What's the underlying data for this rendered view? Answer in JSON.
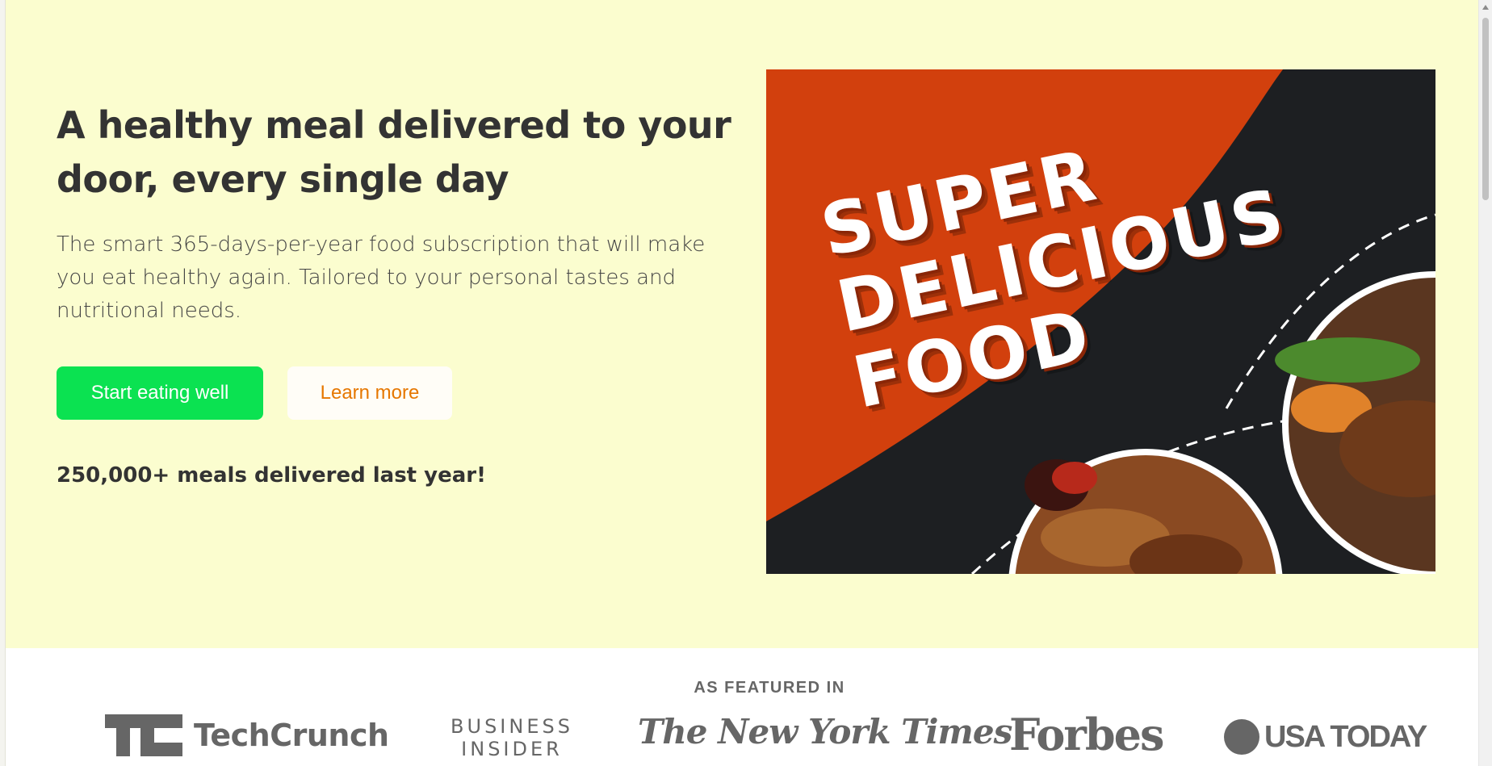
{
  "hero": {
    "heading": "A healthy meal delivered to your door, every single day",
    "description": "The smart 365-days-per-year food subscription that will make you eat healthy again. Tailored to your personal tastes and nutritional needs.",
    "primary_button": "Start eating well",
    "secondary_button": "Learn more",
    "stat": "250,000+ meals delivered last year!"
  },
  "promo_image": {
    "lines": [
      "SUPER",
      "DELICIOUS",
      "FOOD"
    ]
  },
  "featured": {
    "label": "AS FEATURED IN",
    "logos": {
      "techcrunch": "TechCrunch",
      "business_insider_line1": "BUSINESS",
      "business_insider_line2": "INSIDER",
      "nyt": "The New York Times",
      "forbes": "Forbes",
      "usatoday": "USA TODAY"
    }
  },
  "colors": {
    "hero_bg": "#fbfdcf",
    "primary_button": "#0be251",
    "secondary_text": "#e67700",
    "promo_orange": "#d2400d",
    "promo_dark": "#1d1f22"
  }
}
